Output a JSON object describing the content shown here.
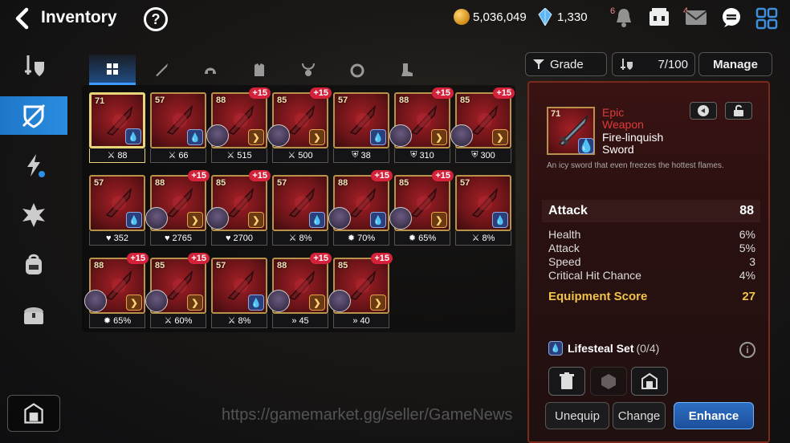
{
  "header": {
    "title": "Inventory",
    "help_label": "?",
    "gold": "5,036,049",
    "crystals": "1,330",
    "notif_count": "6",
    "mail_count": "4"
  },
  "tabs": [
    {
      "name": "all",
      "icon": "grid-icon"
    },
    {
      "name": "weapon",
      "icon": "sword-icon"
    },
    {
      "name": "helmet",
      "icon": "helmet-icon"
    },
    {
      "name": "armor",
      "icon": "armor-icon"
    },
    {
      "name": "necklace",
      "icon": "necklace-icon"
    },
    {
      "name": "ring",
      "icon": "ring-icon"
    },
    {
      "name": "boots",
      "icon": "boots-icon"
    }
  ],
  "controls": {
    "grade_label": "Grade",
    "capacity": "7/100",
    "manage_label": "Manage"
  },
  "items": [
    {
      "level": "71",
      "plus": "",
      "stat_icon": "attack",
      "stat": "88",
      "set": "blue",
      "hero": false,
      "selected": true
    },
    {
      "level": "57",
      "plus": "",
      "stat_icon": "attack",
      "stat": "66",
      "set": "blue",
      "hero": false
    },
    {
      "level": "88",
      "plus": "+15",
      "stat_icon": "attack",
      "stat": "515",
      "set": "orange",
      "hero": true
    },
    {
      "level": "85",
      "plus": "+15",
      "stat_icon": "attack",
      "stat": "500",
      "set": "orange",
      "hero": true
    },
    {
      "level": "57",
      "plus": "",
      "stat_icon": "defense",
      "stat": "38",
      "set": "blue",
      "hero": false
    },
    {
      "level": "88",
      "plus": "+15",
      "stat_icon": "defense",
      "stat": "310",
      "set": "orange",
      "hero": true
    },
    {
      "level": "85",
      "plus": "+15",
      "stat_icon": "defense",
      "stat": "300",
      "set": "orange",
      "hero": true
    },
    {
      "level": "57",
      "plus": "",
      "stat_icon": "health",
      "stat": "352",
      "set": "blue",
      "hero": false
    },
    {
      "level": "88",
      "plus": "+15",
      "stat_icon": "health",
      "stat": "2765",
      "set": "orange",
      "hero": true
    },
    {
      "level": "85",
      "plus": "+15",
      "stat_icon": "health",
      "stat": "2700",
      "set": "orange",
      "hero": true
    },
    {
      "level": "57",
      "plus": "",
      "stat_icon": "attack",
      "stat": "8%",
      "set": "blue",
      "hero": false
    },
    {
      "level": "88",
      "plus": "+15",
      "stat_icon": "crit",
      "stat": "70%",
      "set": "blue",
      "hero": true
    },
    {
      "level": "85",
      "plus": "+15",
      "stat_icon": "crit",
      "stat": "65%",
      "set": "orange",
      "hero": true
    },
    {
      "level": "57",
      "plus": "",
      "stat_icon": "attack",
      "stat": "8%",
      "set": "blue",
      "hero": false
    },
    {
      "level": "88",
      "plus": "+15",
      "stat_icon": "crit",
      "stat": "65%",
      "set": "orange",
      "hero": true
    },
    {
      "level": "85",
      "plus": "+15",
      "stat_icon": "attack",
      "stat": "60%",
      "set": "orange",
      "hero": true
    },
    {
      "level": "57",
      "plus": "",
      "stat_icon": "attack",
      "stat": "8%",
      "set": "blue",
      "hero": false
    },
    {
      "level": "88",
      "plus": "+15",
      "stat_icon": "speed",
      "stat": "45",
      "set": "orange",
      "hero": true
    },
    {
      "level": "85",
      "plus": "+15",
      "stat_icon": "speed",
      "stat": "40",
      "set": "orange",
      "hero": true
    }
  ],
  "detail": {
    "level": "71",
    "rarity": "Epic",
    "type": "Weapon",
    "name_line1": "Fire-linquish",
    "name_line2": "Sword",
    "description": "An icy sword that even freezes the hottest flames.",
    "main_stat_label": "Attack",
    "main_stat_value": "88",
    "sub_stats": [
      {
        "label": "Health",
        "value": "6%"
      },
      {
        "label": "Attack",
        "value": "5%"
      },
      {
        "label": "Speed",
        "value": "3"
      },
      {
        "label": "Critical Hit Chance",
        "value": "4%"
      }
    ],
    "score_label": "Equipment Score",
    "score_value": "27",
    "set_name": "Lifesteal Set",
    "set_count": "(0/4)",
    "unequip_label": "Unequip",
    "change_label": "Change",
    "enhance_label": "Enhance"
  },
  "watermark": "https://gamemarket.gg/seller/GameNews"
}
